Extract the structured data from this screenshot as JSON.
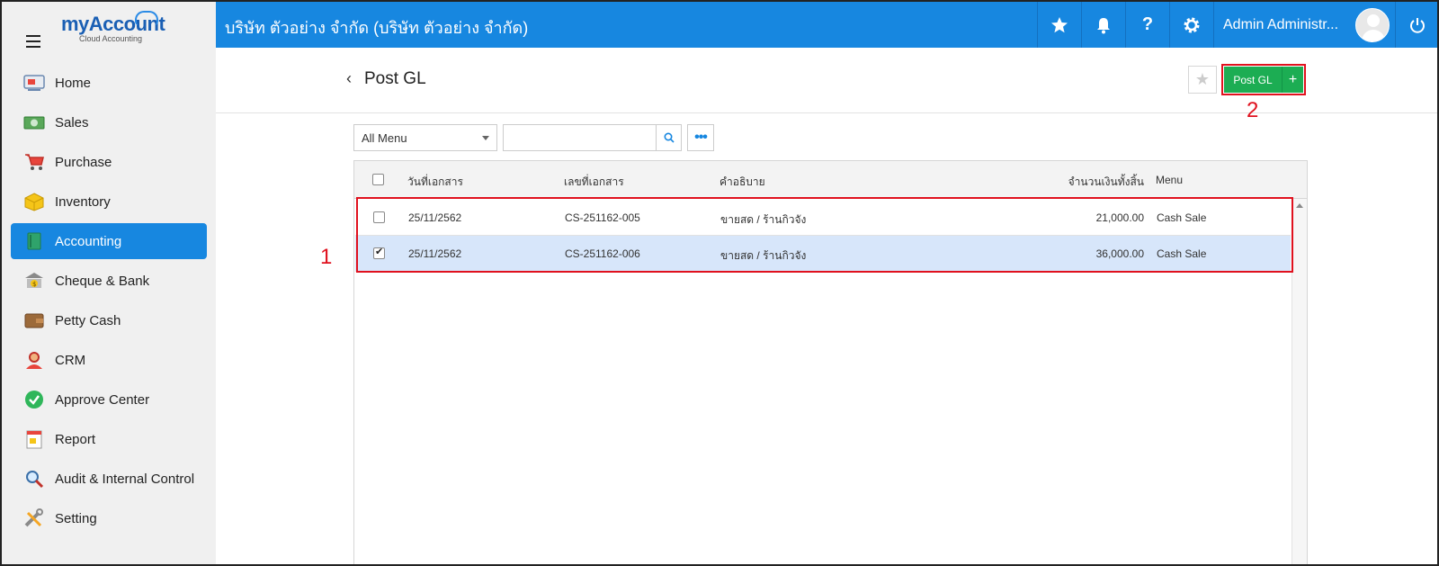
{
  "app": {
    "logo_brand": "myAccount",
    "logo_subtitle": "Cloud Accounting"
  },
  "topbar": {
    "company": "บริษัท ตัวอย่าง จำกัด (บริษัท ตัวอย่าง จำกัด)",
    "user_name": "Admin Administr...",
    "icons": [
      "star-icon",
      "bell-icon",
      "help-icon",
      "gear-icon",
      "power-icon"
    ],
    "accent_color": "#1787e0"
  },
  "sidebar": {
    "items": [
      {
        "label": "Home",
        "icon": "home-icon"
      },
      {
        "label": "Sales",
        "icon": "sales-icon"
      },
      {
        "label": "Purchase",
        "icon": "cart-icon"
      },
      {
        "label": "Inventory",
        "icon": "box-icon"
      },
      {
        "label": "Accounting",
        "icon": "book-icon",
        "active": true
      },
      {
        "label": "Cheque & Bank",
        "icon": "bank-icon"
      },
      {
        "label": "Petty Cash",
        "icon": "wallet-icon"
      },
      {
        "label": "CRM",
        "icon": "person-icon"
      },
      {
        "label": "Approve Center",
        "icon": "check-circle-icon"
      },
      {
        "label": "Report",
        "icon": "report-icon"
      },
      {
        "label": "Audit & Internal Control",
        "icon": "magnifier-icon"
      },
      {
        "label": "Setting",
        "icon": "tools-icon"
      }
    ]
  },
  "header": {
    "back_glyph": "‹",
    "title": "Post GL",
    "favorite_glyph": "★",
    "post_button": "Post GL",
    "plus_button": "+",
    "annotation_2": "2"
  },
  "filter": {
    "menu_select": "All Menu",
    "search_value": "",
    "more_glyph": "•••"
  },
  "table": {
    "columns": [
      "วันที่เอกสาร",
      "เลขที่เอกสาร",
      "คำอธิบาย",
      "จำนวนเงินทั้งสิ้น",
      "Menu"
    ],
    "rows": [
      {
        "date": "25/11/2562",
        "doc_no": "CS-251162-005",
        "description": "ขายสด / ร้านกิวจัง",
        "amount": "21,000.00",
        "menu": "Cash Sale",
        "checked": false
      },
      {
        "date": "25/11/2562",
        "doc_no": "CS-251162-006",
        "description": "ขายสด / ร้านกิวจัง",
        "amount": "36,000.00",
        "menu": "Cash Sale",
        "checked": true
      }
    ],
    "annotation_1": "1"
  },
  "colors": {
    "post_button": "#1cad53",
    "annotation": "#e0111e",
    "selected_row": "#d7e6fa"
  }
}
